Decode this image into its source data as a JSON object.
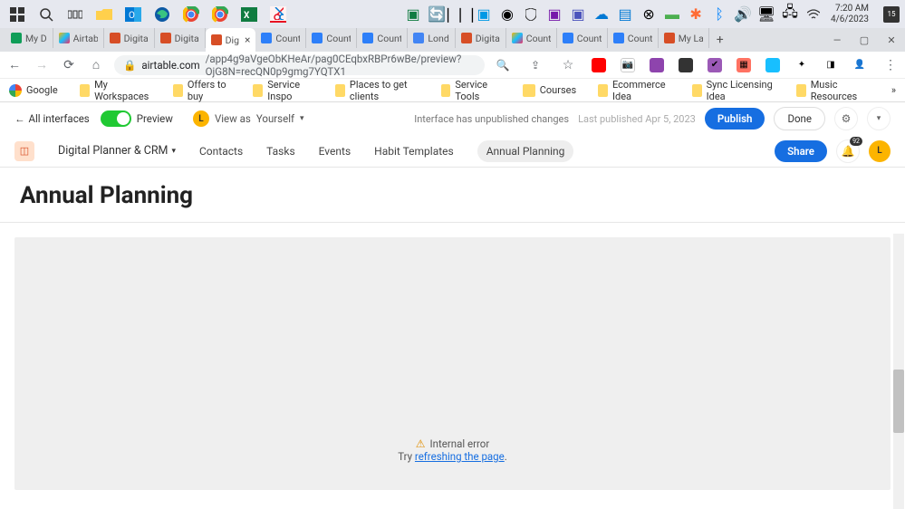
{
  "system": {
    "clock_time": "7:20 AM",
    "clock_date": "4/6/2023",
    "notification_badge": "15"
  },
  "browser": {
    "tabs": [
      {
        "label": "My D",
        "favicon": "gdrive"
      },
      {
        "label": "Airtab",
        "favicon": "airtable"
      },
      {
        "label": "Digita",
        "favicon": "at-orange"
      },
      {
        "label": "Digita",
        "favicon": "at-orange"
      },
      {
        "label": "Dig",
        "favicon": "at-orange",
        "active": true
      },
      {
        "label": "Count",
        "favicon": "at-blue"
      },
      {
        "label": "Count",
        "favicon": "at-blue"
      },
      {
        "label": "Count",
        "favicon": "at-blue"
      },
      {
        "label": "Lond",
        "favicon": "gcal"
      },
      {
        "label": "Digita",
        "favicon": "at-orange"
      },
      {
        "label": "Count",
        "favicon": "airtable"
      },
      {
        "label": "Count",
        "favicon": "at-blue"
      },
      {
        "label": "Count",
        "favicon": "at-blue"
      },
      {
        "label": "My La",
        "favicon": "at-orange-lock"
      }
    ],
    "url_host": "airtable.com",
    "url_path": "/app4g9aVgeObKHeAr/pag0CEqbxRBPr6wBe/preview?OjG8N=recQN0p9gmg7YQTX1",
    "bookmarks": [
      "Google",
      "My Workspaces",
      "Offers to buy",
      "Service Inspo",
      "Places to get clients",
      "Service Tools",
      "Courses",
      "Ecommerce Idea",
      "Sync Licensing Idea",
      "Music Resources"
    ]
  },
  "interface_bar": {
    "back_label": "All interfaces",
    "preview_label": "Preview",
    "viewas_prefix": "View as",
    "viewas_name": "Yourself",
    "unpub_text": "Interface has unpublished changes",
    "last_pub": "Last published Apr 5, 2023",
    "publish_btn": "Publish",
    "done_btn": "Done"
  },
  "app_nav": {
    "app_name": "Digital Planner & CRM",
    "links": [
      "Contacts",
      "Tasks",
      "Events",
      "Habit Templates",
      "Annual Planning"
    ],
    "active_index": 4,
    "share_btn": "Share",
    "bell_badge": "92",
    "avatar_letter": "L"
  },
  "page": {
    "title": "Annual Planning",
    "error_title": "Internal error",
    "error_prefix": "Try ",
    "error_link": "refreshing the page",
    "error_suffix": "."
  }
}
